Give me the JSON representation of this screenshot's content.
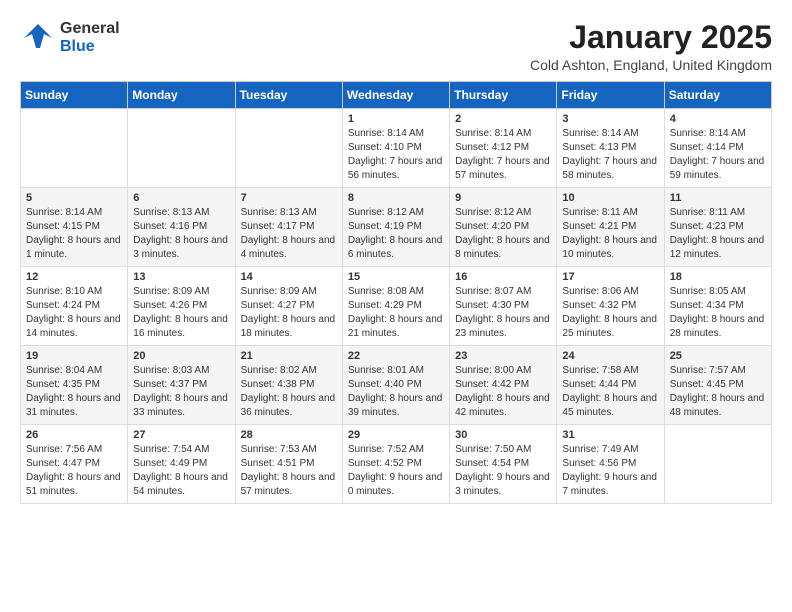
{
  "logo": {
    "general": "General",
    "blue": "Blue"
  },
  "title": "January 2025",
  "subtitle": "Cold Ashton, England, United Kingdom",
  "days_of_week": [
    "Sunday",
    "Monday",
    "Tuesday",
    "Wednesday",
    "Thursday",
    "Friday",
    "Saturday"
  ],
  "weeks": [
    [
      {
        "day": "",
        "info": ""
      },
      {
        "day": "",
        "info": ""
      },
      {
        "day": "",
        "info": ""
      },
      {
        "day": "1",
        "info": "Sunrise: 8:14 AM\nSunset: 4:10 PM\nDaylight: 7 hours and 56 minutes."
      },
      {
        "day": "2",
        "info": "Sunrise: 8:14 AM\nSunset: 4:12 PM\nDaylight: 7 hours and 57 minutes."
      },
      {
        "day": "3",
        "info": "Sunrise: 8:14 AM\nSunset: 4:13 PM\nDaylight: 7 hours and 58 minutes."
      },
      {
        "day": "4",
        "info": "Sunrise: 8:14 AM\nSunset: 4:14 PM\nDaylight: 7 hours and 59 minutes."
      }
    ],
    [
      {
        "day": "5",
        "info": "Sunrise: 8:14 AM\nSunset: 4:15 PM\nDaylight: 8 hours and 1 minute."
      },
      {
        "day": "6",
        "info": "Sunrise: 8:13 AM\nSunset: 4:16 PM\nDaylight: 8 hours and 3 minutes."
      },
      {
        "day": "7",
        "info": "Sunrise: 8:13 AM\nSunset: 4:17 PM\nDaylight: 8 hours and 4 minutes."
      },
      {
        "day": "8",
        "info": "Sunrise: 8:12 AM\nSunset: 4:19 PM\nDaylight: 8 hours and 6 minutes."
      },
      {
        "day": "9",
        "info": "Sunrise: 8:12 AM\nSunset: 4:20 PM\nDaylight: 8 hours and 8 minutes."
      },
      {
        "day": "10",
        "info": "Sunrise: 8:11 AM\nSunset: 4:21 PM\nDaylight: 8 hours and 10 minutes."
      },
      {
        "day": "11",
        "info": "Sunrise: 8:11 AM\nSunset: 4:23 PM\nDaylight: 8 hours and 12 minutes."
      }
    ],
    [
      {
        "day": "12",
        "info": "Sunrise: 8:10 AM\nSunset: 4:24 PM\nDaylight: 8 hours and 14 minutes."
      },
      {
        "day": "13",
        "info": "Sunrise: 8:09 AM\nSunset: 4:26 PM\nDaylight: 8 hours and 16 minutes."
      },
      {
        "day": "14",
        "info": "Sunrise: 8:09 AM\nSunset: 4:27 PM\nDaylight: 8 hours and 18 minutes."
      },
      {
        "day": "15",
        "info": "Sunrise: 8:08 AM\nSunset: 4:29 PM\nDaylight: 8 hours and 21 minutes."
      },
      {
        "day": "16",
        "info": "Sunrise: 8:07 AM\nSunset: 4:30 PM\nDaylight: 8 hours and 23 minutes."
      },
      {
        "day": "17",
        "info": "Sunrise: 8:06 AM\nSunset: 4:32 PM\nDaylight: 8 hours and 25 minutes."
      },
      {
        "day": "18",
        "info": "Sunrise: 8:05 AM\nSunset: 4:34 PM\nDaylight: 8 hours and 28 minutes."
      }
    ],
    [
      {
        "day": "19",
        "info": "Sunrise: 8:04 AM\nSunset: 4:35 PM\nDaylight: 8 hours and 31 minutes."
      },
      {
        "day": "20",
        "info": "Sunrise: 8:03 AM\nSunset: 4:37 PM\nDaylight: 8 hours and 33 minutes."
      },
      {
        "day": "21",
        "info": "Sunrise: 8:02 AM\nSunset: 4:38 PM\nDaylight: 8 hours and 36 minutes."
      },
      {
        "day": "22",
        "info": "Sunrise: 8:01 AM\nSunset: 4:40 PM\nDaylight: 8 hours and 39 minutes."
      },
      {
        "day": "23",
        "info": "Sunrise: 8:00 AM\nSunset: 4:42 PM\nDaylight: 8 hours and 42 minutes."
      },
      {
        "day": "24",
        "info": "Sunrise: 7:58 AM\nSunset: 4:44 PM\nDaylight: 8 hours and 45 minutes."
      },
      {
        "day": "25",
        "info": "Sunrise: 7:57 AM\nSunset: 4:45 PM\nDaylight: 8 hours and 48 minutes."
      }
    ],
    [
      {
        "day": "26",
        "info": "Sunrise: 7:56 AM\nSunset: 4:47 PM\nDaylight: 8 hours and 51 minutes."
      },
      {
        "day": "27",
        "info": "Sunrise: 7:54 AM\nSunset: 4:49 PM\nDaylight: 8 hours and 54 minutes."
      },
      {
        "day": "28",
        "info": "Sunrise: 7:53 AM\nSunset: 4:51 PM\nDaylight: 8 hours and 57 minutes."
      },
      {
        "day": "29",
        "info": "Sunrise: 7:52 AM\nSunset: 4:52 PM\nDaylight: 9 hours and 0 minutes."
      },
      {
        "day": "30",
        "info": "Sunrise: 7:50 AM\nSunset: 4:54 PM\nDaylight: 9 hours and 3 minutes."
      },
      {
        "day": "31",
        "info": "Sunrise: 7:49 AM\nSunset: 4:56 PM\nDaylight: 9 hours and 7 minutes."
      },
      {
        "day": "",
        "info": ""
      }
    ]
  ]
}
